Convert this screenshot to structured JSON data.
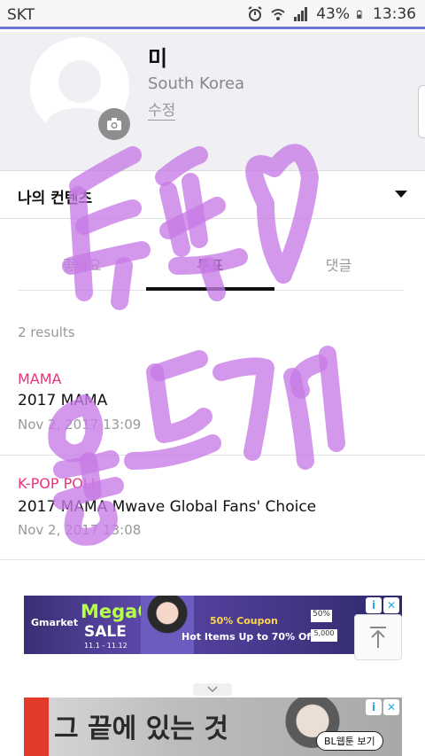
{
  "status_bar": {
    "carrier": "SKT",
    "battery": "43%",
    "time": "13:36"
  },
  "profile": {
    "name": "미",
    "country": "South Korea",
    "edit_label": "수정"
  },
  "contents": {
    "label": "나의 컨텐츠"
  },
  "tabs": [
    {
      "label": "좋아요",
      "active": false
    },
    {
      "label": "투표",
      "active": true
    },
    {
      "label": "댓글",
      "active": false
    }
  ],
  "results_count": "2 results",
  "items": [
    {
      "category": "MAMA",
      "title": "2017 MAMA",
      "date": "Nov 2, 2017 13:09"
    },
    {
      "category": "K-POP POLL",
      "title": "2017 MAMA Mwave Global Fans' Choice",
      "date": "Nov 2, 2017 13:08"
    }
  ],
  "ads": [
    {
      "brand": "Gmarket",
      "headline": "MegaG",
      "sub": "SALE",
      "dates": "11.1 - 11.12",
      "offer1": "50% Coupon",
      "offer2": "Hot Items Up to 70% Off!",
      "chip1": "50%",
      "chip2": "5,000"
    },
    {
      "title": "그 끝에 있는 것",
      "button": "BL웹툰 보기"
    }
  ],
  "overlay_text": "득표 ♡ 웡드기",
  "colors": {
    "accent_pink": "#e6347c",
    "status_line": "#6f74d8",
    "scribble": "#c77be6"
  }
}
